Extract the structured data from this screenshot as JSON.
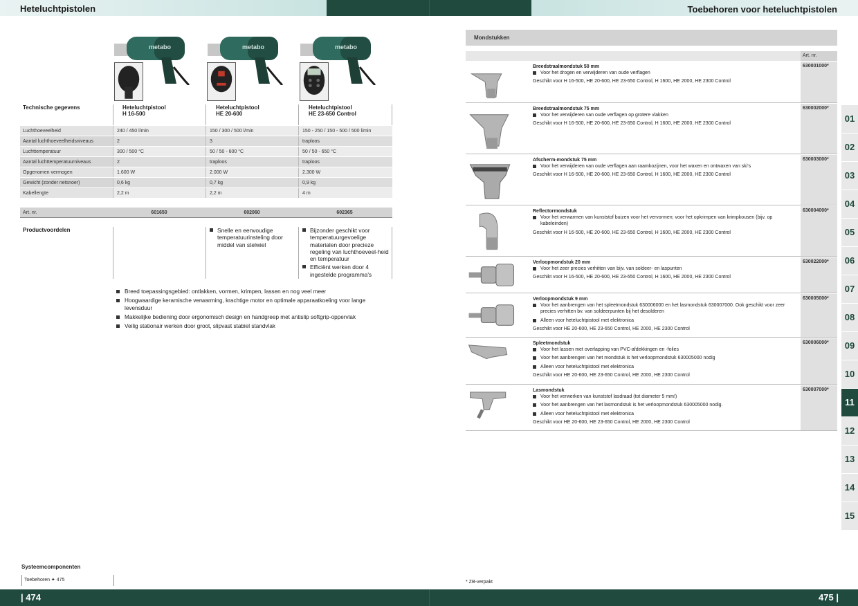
{
  "header": {
    "left_title": "Heteluchtpistolen",
    "right_title": "Toebehoren voor heteluchtpistolen"
  },
  "footer": {
    "left_page": "| 474",
    "right_page": "475 |"
  },
  "brand": "metabo",
  "spec": {
    "label": "Technische gegevens",
    "models": [
      {
        "line1": "Heteluchtpistool",
        "line2": "H 16-500"
      },
      {
        "line1": "Heteluchtpistool",
        "line2": "HE 20-600"
      },
      {
        "line1": "Heteluchtpistool",
        "line2": "HE 23-650 Control"
      }
    ],
    "rows": [
      {
        "name": "Luchthoeveelheid",
        "v": [
          "240 / 450 l/min",
          "150 / 300 / 500 l/min",
          "150 - 250 / 150 - 500 / 500 l/min"
        ]
      },
      {
        "name": "Aantal luchthoeveelheidsniveaus",
        "v": [
          "2",
          "3",
          "traploos"
        ]
      },
      {
        "name": "Luchttemperatuur",
        "v": [
          "300 / 500 °C",
          "50 / 50 - 600 °C",
          "50 / 50 - 650 °C"
        ]
      },
      {
        "name": "Aantal luchttemperatuurniveaus",
        "v": [
          "2",
          "traploos",
          "traploos"
        ]
      },
      {
        "name": "Opgenomen vermogen",
        "v": [
          "1.600 W",
          "2.000 W",
          "2.300 W"
        ]
      },
      {
        "name": "Gewicht (zonder netsnoer)",
        "v": [
          "0,6 kg",
          "0,7 kg",
          "0,9 kg"
        ]
      },
      {
        "name": "Kabellengte",
        "v": [
          "2,2 m",
          "2,2 m",
          "4 m"
        ]
      }
    ],
    "art_label": "Art. nr.",
    "art_numbers": [
      "601650",
      "602060",
      "602365"
    ]
  },
  "advantages": {
    "label": "Productvoordelen",
    "col2": [
      "Snelle en eenvoudige temperatuurinsteling door middel van stelwiel"
    ],
    "col3": [
      "Bijzonder geschikt voor temperatuurgevoelige materialen door precieze regeling van luchthoeveel-heid en temperatuur",
      "Efficiënt werken door 4 ingestelde programma's"
    ],
    "general": [
      "Breed toepassingsgebied: ontlakken, vormen, krimpen, lassen en nog veel meer",
      "Hoogwaardige keramische verwarming, krachtige motor en optimale apparaatkoeling voor lange levensduur",
      "Makkelijke bediening door ergonomisch design en handgreep met antislip softgrip-oppervlak",
      "Veilig stationair werken door groot, slipvast stabiel standvlak"
    ]
  },
  "system": {
    "title": "Systeemcomponenten",
    "link": "Toebehoren ✦ 475"
  },
  "accessories": {
    "section": "Mondstukken",
    "art_head": "Art. nr.",
    "items": [
      {
        "title": "Breedstraalmondstuk 50 mm",
        "bullets": [
          "Voor het drogen en verwijderen van oude verflagen"
        ],
        "fit": "Geschikt voor H 16-500, HE 20-600, HE 23-650 Control, H 1600, HE 2000, HE 2300 Control",
        "art": "630001000*"
      },
      {
        "title": "Breedstraalmondstuk 75 mm",
        "bullets": [
          "Voor het verwijderen van oude verflagen op grotere vlakken"
        ],
        "fit": "Geschikt voor H 16-500, HE 20-600, HE 23-650 Control, H 1600, HE 2000, HE 2300 Control",
        "art": "630002000*"
      },
      {
        "title": "Afscherm-mondstuk 75 mm",
        "bullets": [
          "Voor het verwijderen van oude verflagen aan raamkozijnen, voor het waxen en ontwaxen van ski's"
        ],
        "fit": "Geschikt voor H 16-500, HE 20-600, HE 23-650 Control, H 1600, HE 2000, HE 2300 Control",
        "art": "630003000*"
      },
      {
        "title": "Reflectormondstuk",
        "bullets": [
          "Voor het verwarmen van kunststof buizen voor het vervormen; voor het opkrimpen van krimpkousen (bijv. op kabeleinden)"
        ],
        "fit": "Geschikt voor H 16-500, HE 20-600, HE 23-650 Control, H 1600, HE 2000, HE 2300 Control",
        "art": "630004000*"
      },
      {
        "title": "Verloopmondstuk 20 mm",
        "bullets": [
          "Voor het zeer precies verhitten van bijv. van soldeer- en laspunten"
        ],
        "fit": "Geschikt voor H 16-500, HE 20-600, HE 23-650 Control, H 1600, HE 2000, HE 2300 Control",
        "art": "630022000*"
      },
      {
        "title": "Verloopmondstuk 9 mm",
        "bullets": [
          "Voor het aanbrengen van het spleetmondstuk 630006000 en het lasmondstuk 630007000. Ook geschikt voor zeer precies verhitten bv. van soldeerpunten bij het desolderen",
          "Alleen voor heteluchtpistool met elektronica"
        ],
        "fit": "Geschikt voor HE 20-600, HE 23-650 Control, HE 2000, HE 2300 Control",
        "art": "630005000*"
      },
      {
        "title": "Spleetmondstuk",
        "bullets": [
          "Voor het lassen met overlapping van PVC-afdekkingen en -folies",
          "Voor het aanbrengen van het mondstuk is het verloopmondstuk 630005000 nodig",
          "Alleen voor heteluchtpistool met elektronica"
        ],
        "fit": "Geschikt voor HE 20-600, HE 23-650 Control, HE 2000, HE 2300 Control",
        "art": "630006000*"
      },
      {
        "title": "Lasmondstuk",
        "bullets": [
          "Voor het verwerken van kunststof lasdraad (tot diameter 5 mm!)",
          "Voor het aanbrengen van het lasmondstuk is het verloopmondstuk 630005000 nodig.",
          "Alleen voor heteluchtpistool met elektronica"
        ],
        "fit": "Geschikt voor HE 20-600, HE 23-650 Control, HE 2000, HE 2300 Control",
        "art": "630007000*"
      }
    ]
  },
  "footnote": "* ZB-verpakt",
  "tabs": [
    "01",
    "02",
    "03",
    "04",
    "05",
    "06",
    "07",
    "08",
    "09",
    "10",
    "11",
    "12",
    "13",
    "14",
    "15"
  ],
  "active_tab": "11",
  "colors": {
    "brand_green": "#1f4a3d",
    "header_teal": "#c8e3e1",
    "gun_green": "#2f6b5e"
  }
}
